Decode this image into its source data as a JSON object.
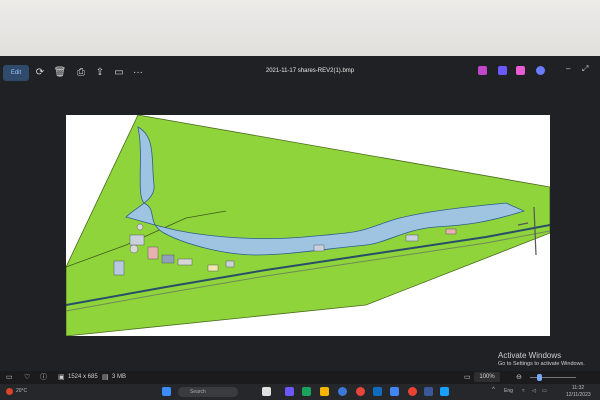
{
  "viewer": {
    "toolbar": {
      "edit_label": "Edit",
      "filename": "2021-11-17 shares-REV2(1).bmp",
      "more_label": "···"
    },
    "status": {
      "dimensions": "1524 x 685",
      "filesize": "3 MB",
      "zoom": "100%"
    }
  },
  "activation": {
    "title": "Activate Windows",
    "subtitle": "Go to Settings to activate Windows."
  },
  "taskbar": {
    "weather": "20°C",
    "search_placeholder": "Search",
    "language": "Eng",
    "time": "11:32",
    "date": "12/11/2023"
  },
  "colors": {
    "grass": "#8fd43a",
    "river": "#9fc4e2",
    "accent": "#2f4a6a"
  }
}
